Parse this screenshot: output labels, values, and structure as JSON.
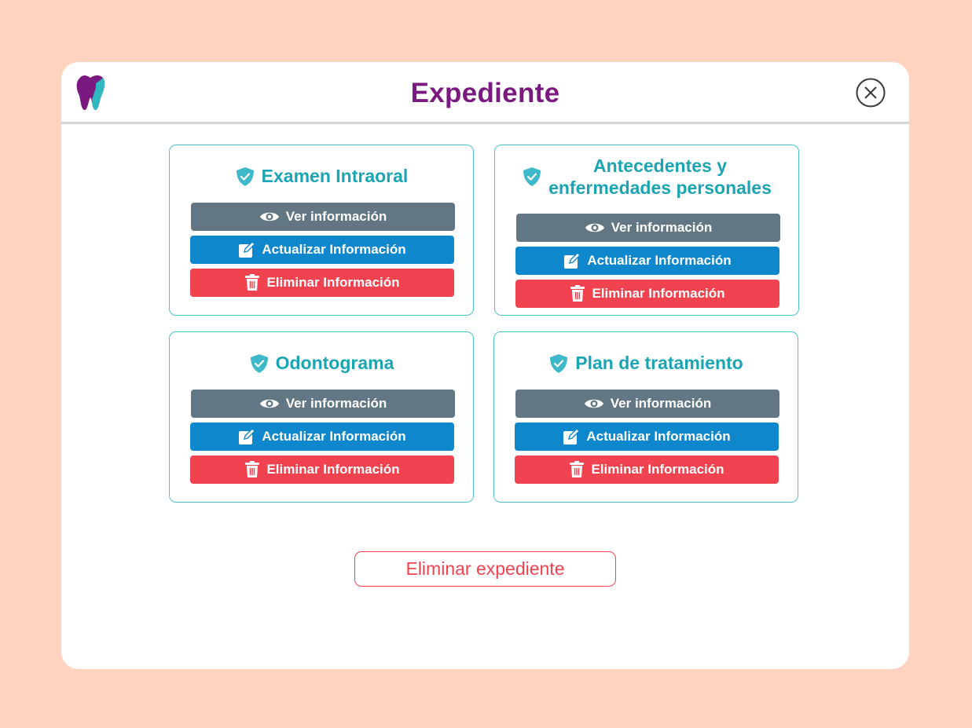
{
  "modal": {
    "title": "Expediente",
    "logo_icon": "tooth-icon",
    "close_icon": "close-circle-icon"
  },
  "cards": [
    {
      "title_lines": [
        "Examen Intraoral"
      ],
      "view_label": "Ver información",
      "update_label": "Actualizar Información",
      "delete_label": "Eliminar Información"
    },
    {
      "title_lines": [
        "Antecedentes y",
        "enfermedades personales"
      ],
      "view_label": "Ver información",
      "update_label": "Actualizar Información",
      "delete_label": "Eliminar Información"
    },
    {
      "title_lines": [
        "Odontograma"
      ],
      "view_label": "Ver información",
      "update_label": "Actualizar Información",
      "delete_label": "Eliminar Información"
    },
    {
      "title_lines": [
        "Plan de tratamiento"
      ],
      "view_label": "Ver información",
      "update_label": "Actualizar Información",
      "delete_label": "Eliminar Información"
    }
  ],
  "footer": {
    "delete_record_label": "Eliminar expediente"
  },
  "icons": {
    "card_title": "shield-check-icon",
    "view": "eye-icon",
    "update": "edit-icon",
    "delete": "trash-icon"
  },
  "colors": {
    "background": "#ffd3bf",
    "title": "#7a1a80",
    "accent": "#1ba4b1",
    "view_button": "#627683",
    "update_button": "#0f87cc",
    "delete_button": "#f1434f"
  }
}
